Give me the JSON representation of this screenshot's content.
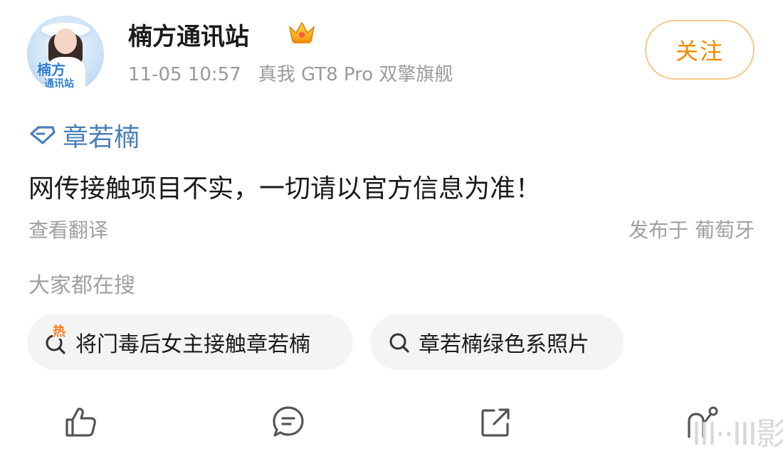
{
  "post": {
    "author": "楠方通讯站",
    "avatar_text_line1": "楠方",
    "avatar_text_line2": "通讯站",
    "timestamp": "11-05 10:57",
    "device": "真我 GT8 Pro 双擎旗舰",
    "follow_label": "关注",
    "topic": "章若楠",
    "content": "网传接触项目不实，一切请以官方信息为准！",
    "translate_label": "查看翻译",
    "location": "发布于 葡萄牙"
  },
  "search": {
    "title": "大家都在搜",
    "chips": [
      {
        "hot_badge": "热",
        "label": "将门毒后女主接触章若楠"
      },
      {
        "label": "章若楠绿色系照片"
      }
    ]
  },
  "actions": {
    "like_icon": "thumbs-up-icon",
    "comment_icon": "comment-icon",
    "share_icon": "share-icon",
    "more_icon": "more-icon"
  },
  "watermark": "III··III影",
  "colors": {
    "accent_orange": "#f08a00",
    "follow_border": "#f5c98a",
    "topic_blue": "#4a7fb7",
    "hot_orange": "#ff7a1a",
    "chip_bg": "#f4f4f4",
    "muted_text": "#9a9a9a"
  }
}
